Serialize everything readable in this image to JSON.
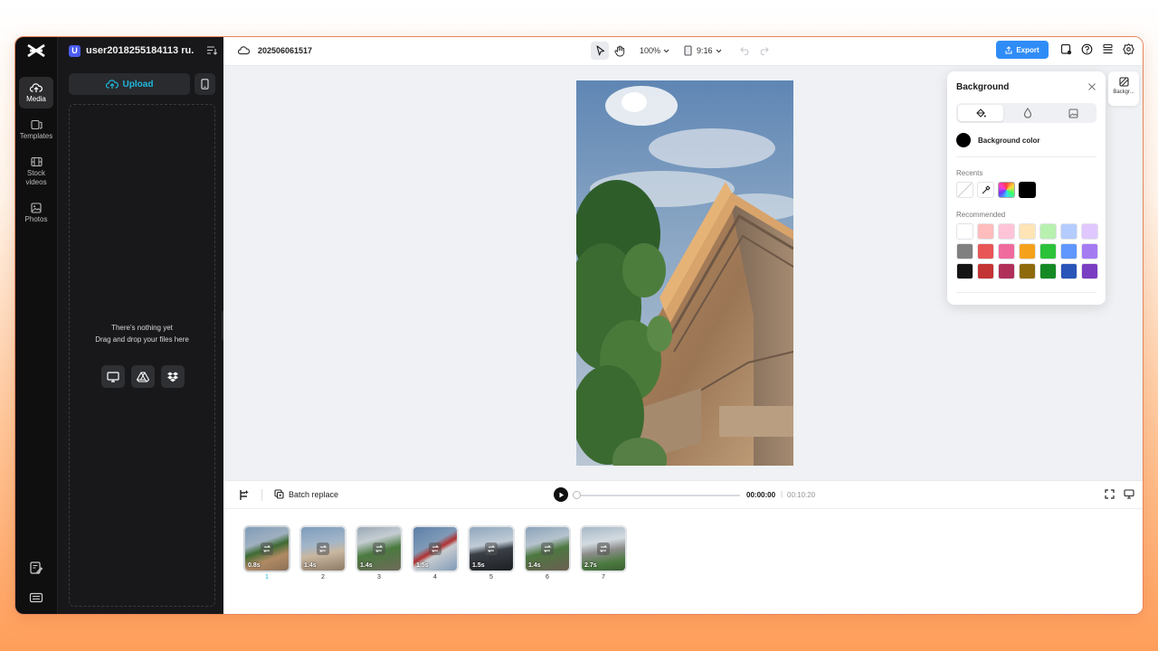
{
  "sidebar": {
    "items": [
      {
        "label": "Media",
        "icon": "cloud-upload-icon"
      },
      {
        "label": "Templates",
        "icon": "templates-icon"
      },
      {
        "label": "Stock videos",
        "icon": "film-icon"
      },
      {
        "label": "Photos",
        "icon": "image-icon"
      }
    ]
  },
  "panel": {
    "avatar_letter": "U",
    "user_name": "user2018255184113 ru...",
    "upload_label": "Upload",
    "empty_line1": "There's nothing yet",
    "empty_line2": "Drag and drop your files here"
  },
  "topbar": {
    "project_name": "202506061517",
    "zoom": "100%",
    "aspect": "9:16",
    "export_label": "Export"
  },
  "side_tab": {
    "label": "Backgr..."
  },
  "background_panel": {
    "title": "Background",
    "bg_color_label": "Background color",
    "recents_label": "Recents",
    "recommended_label": "Recommended",
    "recent_colors": [
      "none",
      "picker",
      "gradient",
      "#000000"
    ],
    "recommended_colors": [
      [
        "#ffffff",
        "#ffbcbc",
        "#ffc3d8",
        "#ffe4b5",
        "#b8f0b0",
        "#b5ccff",
        "#e0c8ff"
      ],
      [
        "#808080",
        "#e85656",
        "#ef6b9e",
        "#f5a21a",
        "#2cc23a",
        "#5f97ff",
        "#a57bf2"
      ],
      [
        "#141414",
        "#c43434",
        "#b0305a",
        "#8f6a0c",
        "#158a24",
        "#2a55b8",
        "#7a3ec2"
      ]
    ]
  },
  "timeline": {
    "batch_label": "Batch replace",
    "current_time": "00:00:00",
    "separator": "|",
    "total_time": "00:10:20",
    "clips": [
      {
        "duration": "0.8s",
        "number": "1"
      },
      {
        "duration": "1.4s",
        "number": "2"
      },
      {
        "duration": "1.4s",
        "number": "3"
      },
      {
        "duration": "1.5s",
        "number": "4"
      },
      {
        "duration": "1.5s",
        "number": "5"
      },
      {
        "duration": "1.4s",
        "number": "6"
      },
      {
        "duration": "2.7s",
        "number": "7"
      }
    ]
  }
}
